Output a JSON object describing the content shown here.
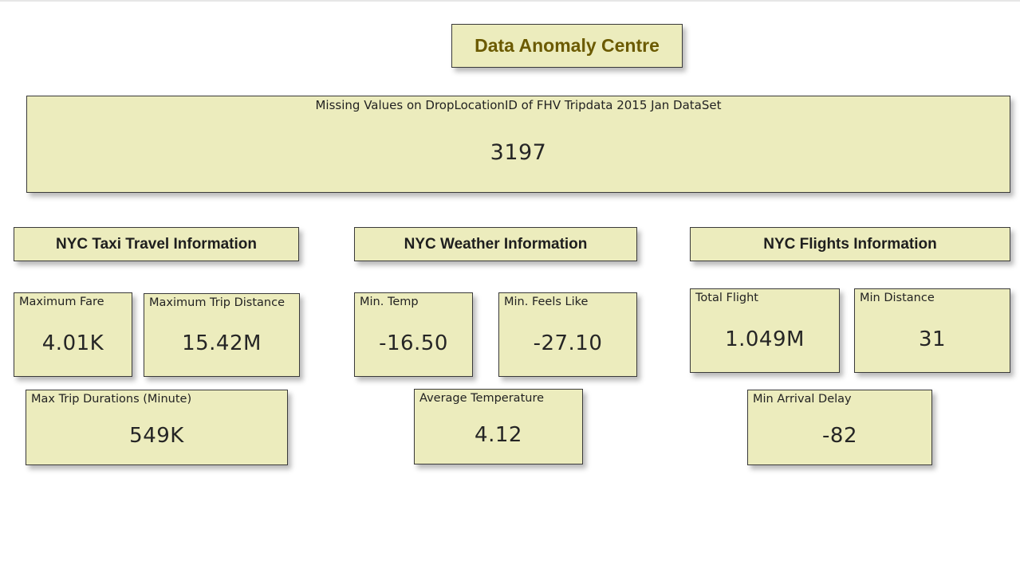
{
  "page_title": "Data Anomaly Centre",
  "missing_values": {
    "label": "Missing Values on DropLocationID of FHV Tripdata 2015 Jan DataSet",
    "value": "3197"
  },
  "taxi": {
    "title": "NYC Taxi Travel Information",
    "max_fare": {
      "label": "Maximum Fare",
      "value": "4.01K"
    },
    "max_trip_distance": {
      "label": "Maximum Trip Distance",
      "value": "15.42M"
    },
    "max_trip_duration": {
      "label": "Max Trip Durations (Minute)",
      "value": "549K"
    }
  },
  "weather": {
    "title": "NYC Weather Information",
    "min_temp": {
      "label": "Min. Temp",
      "value": "-16.50"
    },
    "min_feels_like": {
      "label": "Min. Feels Like",
      "value": "-27.10"
    },
    "avg_temp": {
      "label": "Average Temperature",
      "value": "4.12"
    }
  },
  "flights": {
    "title": "NYC Flights Information",
    "total_flight": {
      "label": "Total Flight",
      "value": "1.049M"
    },
    "min_distance": {
      "label": "Min Distance",
      "value": "31"
    },
    "min_arrival_delay": {
      "label": "Min Arrival Delay",
      "value": "-82"
    }
  },
  "colors": {
    "card_background": "#ececbd",
    "title_text": "#6b5a00",
    "border": "#3a3a3a"
  }
}
